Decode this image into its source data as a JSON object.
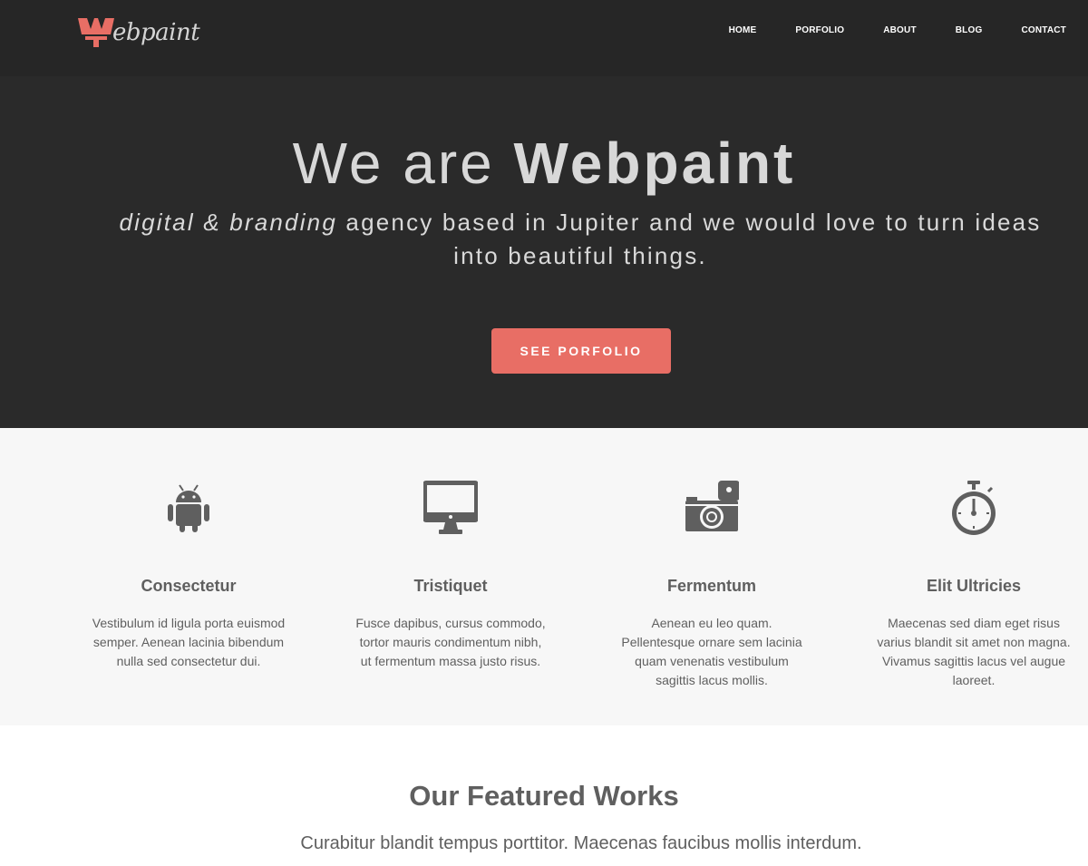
{
  "brand": {
    "name": "ebpaint",
    "accent": "#e86e65"
  },
  "nav": {
    "items": [
      "HOME",
      "PORFOLIO",
      "ABOUT",
      "BLOG",
      "CONTACT"
    ]
  },
  "hero": {
    "title_prefix": "We are ",
    "title_bold": "Webpaint",
    "subtitle_italic": "digital & branding",
    "subtitle_rest": " agency based in Jupiter and we would love to turn ideas into beautiful things.",
    "cta_label": "SEE PORFOLIO"
  },
  "features": [
    {
      "icon": "android-icon",
      "title": "Consectetur",
      "text": "Vestibulum id ligula porta euismod semper. Aenean lacinia bibendum nulla sed consectetur dui."
    },
    {
      "icon": "monitor-icon",
      "title": "Tristiquet",
      "text": "Fusce dapibus, cursus commodo, tortor mauris condimentum nibh, ut fermentum massa justo risus."
    },
    {
      "icon": "camera-icon",
      "title": "Fermentum",
      "text": "Aenean eu leo quam. Pellentesque ornare sem lacinia quam venenatis vestibulum sagittis lacus mollis."
    },
    {
      "icon": "stopwatch-icon",
      "title": "Elit Ultricies",
      "text": "Maecenas sed diam eget risus varius blandit sit amet non magna. Vivamus sagittis lacus vel augue laoreet."
    }
  ],
  "works": {
    "title": "Our Featured Works",
    "subtitle": "Curabitur blandit tempus porttitor. Maecenas faucibus mollis interdum."
  }
}
